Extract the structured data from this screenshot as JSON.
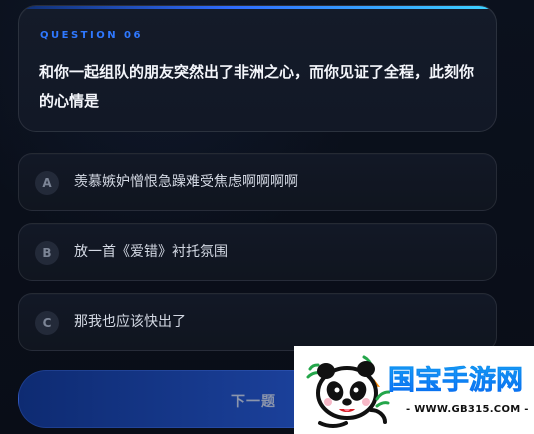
{
  "question": {
    "label": "QUESTION 06",
    "text": "和你一起组队的朋友突然出了非洲之心，而你见证了全程，此刻你的心情是"
  },
  "options": [
    {
      "letter": "A",
      "text": "羡慕嫉妒憎恨急躁难受焦虑啊啊啊啊"
    },
    {
      "letter": "B",
      "text": "放一首《爱错》衬托氛围"
    },
    {
      "letter": "C",
      "text": "那我也应该快出了"
    }
  ],
  "actions": {
    "next_label": "下一题"
  },
  "watermark": {
    "site_name": "国宝手游网",
    "site_url": "- WWW.GB315.COM -",
    "icon": "panda-icon"
  },
  "colors": {
    "background": "#090d17",
    "card": "#141b29",
    "accent": "#2f78ff",
    "button": "#1a3f98",
    "watermark_text": "#0b73ff"
  }
}
